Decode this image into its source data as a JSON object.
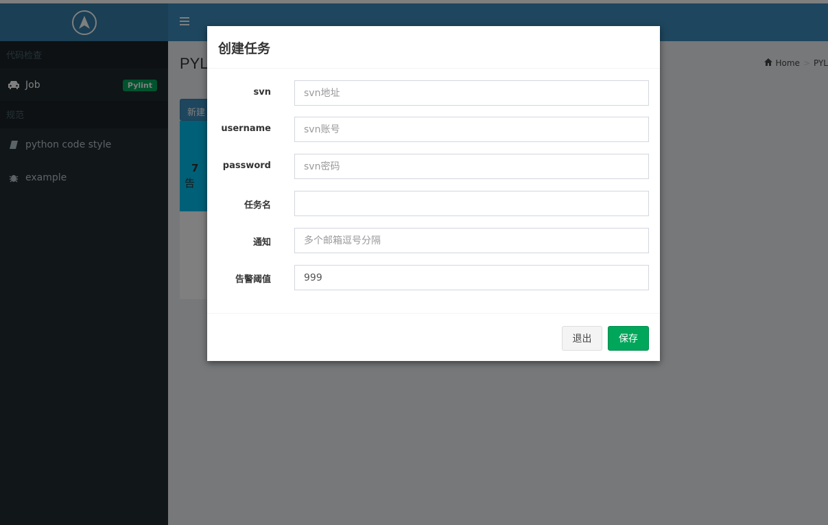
{
  "sidebar": {
    "sections": [
      {
        "header": "代码检查",
        "items": [
          {
            "label": "Job",
            "icon": "car-icon",
            "badge": "Pylint"
          }
        ]
      },
      {
        "header": "规范",
        "items": [
          {
            "label": "python code style",
            "icon": "book-icon"
          },
          {
            "label": "example",
            "icon": "bug-icon"
          }
        ]
      }
    ]
  },
  "content": {
    "page_title": "PYL",
    "breadcrumb": {
      "home": "Home",
      "sep": ">",
      "current": "PYL"
    },
    "new_button": "新建",
    "panel": {
      "number": "7",
      "label": "告"
    }
  },
  "modal": {
    "title": "创建任务",
    "fields": [
      {
        "label": "svn",
        "value": "",
        "placeholder": "svn地址"
      },
      {
        "label": "username",
        "value": "",
        "placeholder": "svn账号"
      },
      {
        "label": "password",
        "value": "",
        "placeholder": "svn密码"
      },
      {
        "label": "任务名",
        "value": "",
        "placeholder": ""
      },
      {
        "label": "通知",
        "value": "",
        "placeholder": "多个邮箱逗号分隔"
      },
      {
        "label": "告警阈值",
        "value": "999",
        "placeholder": ""
      }
    ],
    "cancel_button": "退出",
    "save_button": "保存"
  },
  "colors": {
    "header": "#3c8dbc",
    "sidebar": "#222d32",
    "accent_green": "#00a65a",
    "info": "#00c0ef"
  }
}
